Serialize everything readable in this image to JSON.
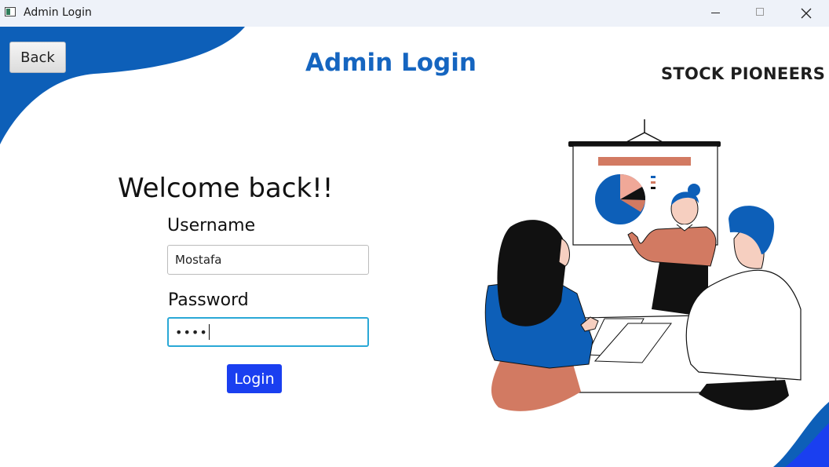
{
  "window": {
    "title": "Admin Login"
  },
  "header": {
    "back_label": "Back",
    "title": "Admin Login",
    "brand": "STOCK PIONEERS"
  },
  "form": {
    "welcome": "Welcome back!!",
    "username_label": "Username",
    "username_value": "Mostafa",
    "password_label": "Password",
    "password_masked": "••••",
    "login_label": "Login"
  },
  "colors": {
    "accent": "#1565c0",
    "login_button": "#1a3ff0",
    "wave": "#0d5fb8",
    "focus_border": "#2aa8d6"
  },
  "icons": [
    "app-icon",
    "minimize-icon",
    "maximize-icon",
    "close-icon"
  ]
}
